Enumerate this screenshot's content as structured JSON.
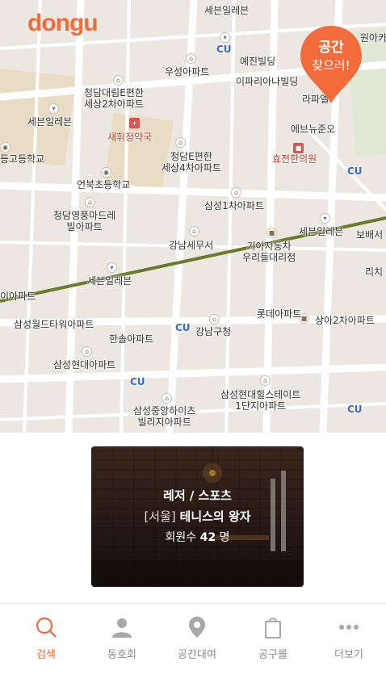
{
  "app": {
    "logo": "dongu"
  },
  "map": {
    "pin": {
      "line1": "공간",
      "line2": "찾으러!"
    },
    "labels": [
      "세븐일레븐",
      "원아카",
      "CU",
      "예진빌딩",
      "우성아파트",
      "이파리아나빌딩",
      "청담대림E편한\n세상2차아파트",
      "라파엘",
      "세븐일레븐",
      "새휘정약국",
      "에브뉴준오",
      "효전한의원",
      "CU",
      "등고등학교",
      "청담E편한\n세상4차아파트",
      "언북초등학교",
      "삼성1차아파트",
      "청담영풍마드레\n빌아파트",
      "세븐일레븐",
      "보배서",
      "강남세무서",
      "기아자동차\n우리들대리점",
      "리치",
      "세븐일레븐",
      "이아파트",
      "삼성월드타워아파트",
      "CU",
      "롯데아파트",
      "상아2차아파트",
      "한솔아파트",
      "강남구청",
      "삼성현대아파트",
      "CU",
      "삼성현대힐스테이트\n1단지아파트",
      "삼성중앙하이츠\n빌리지아파트",
      "CU"
    ]
  },
  "card": {
    "category": "레저 / 스포츠",
    "region": "[서울]",
    "name": "테니스의 왕자",
    "members_label": "회원수",
    "members_count": "42",
    "members_unit": "명"
  },
  "tabs": [
    {
      "label": "검색",
      "icon": "search-icon",
      "active": true
    },
    {
      "label": "동호회",
      "icon": "person-icon",
      "active": false
    },
    {
      "label": "공간대여",
      "icon": "location-pin-icon",
      "active": false
    },
    {
      "label": "공구몰",
      "icon": "shopping-bag-icon",
      "active": false
    },
    {
      "label": "더보기",
      "icon": "more-icon",
      "active": false
    }
  ],
  "colors": {
    "accent": "#f26b3a",
    "tab_inactive": "#8a8a8a"
  }
}
